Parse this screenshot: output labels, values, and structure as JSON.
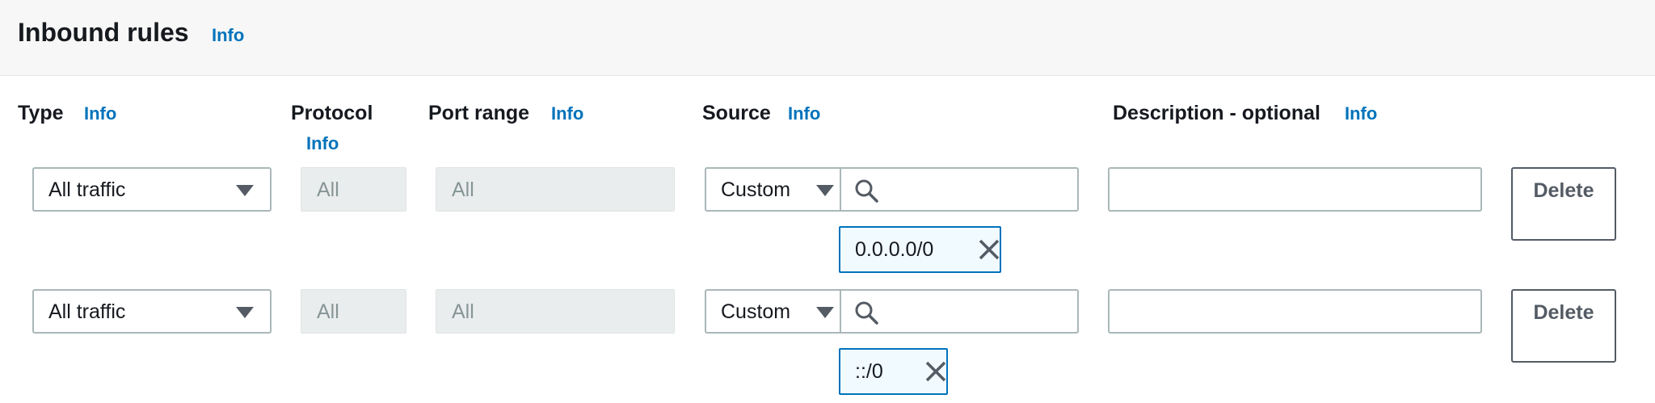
{
  "header": {
    "title": "Inbound rules",
    "info_label": "Info"
  },
  "columns": {
    "type": {
      "label": "Type",
      "info": "Info"
    },
    "protocol": {
      "label": "Protocol",
      "info": "Info"
    },
    "port_range": {
      "label": "Port range",
      "info": "Info"
    },
    "source": {
      "label": "Source",
      "info": "Info"
    },
    "description": {
      "label": "Description - optional",
      "info": "Info"
    }
  },
  "rules": [
    {
      "type": "All traffic",
      "protocol": "All",
      "port_range": "All",
      "source_type": "Custom",
      "search_value": "",
      "cidr_token": "0.0.0.0/0",
      "description": "",
      "delete_label": "Delete"
    },
    {
      "type": "All traffic",
      "protocol": "All",
      "port_range": "All",
      "source_type": "Custom",
      "search_value": "",
      "cidr_token": "::/0",
      "description": "",
      "delete_label": "Delete"
    }
  ],
  "icons": {
    "caret": "caret-down-icon",
    "search": "search-icon",
    "remove": "close-icon"
  },
  "colors": {
    "link": "#0073bb",
    "border": "#aab7b8",
    "readonly_bg": "#eaeded",
    "token_bg": "#f1faff",
    "token_border": "#0073bb"
  }
}
